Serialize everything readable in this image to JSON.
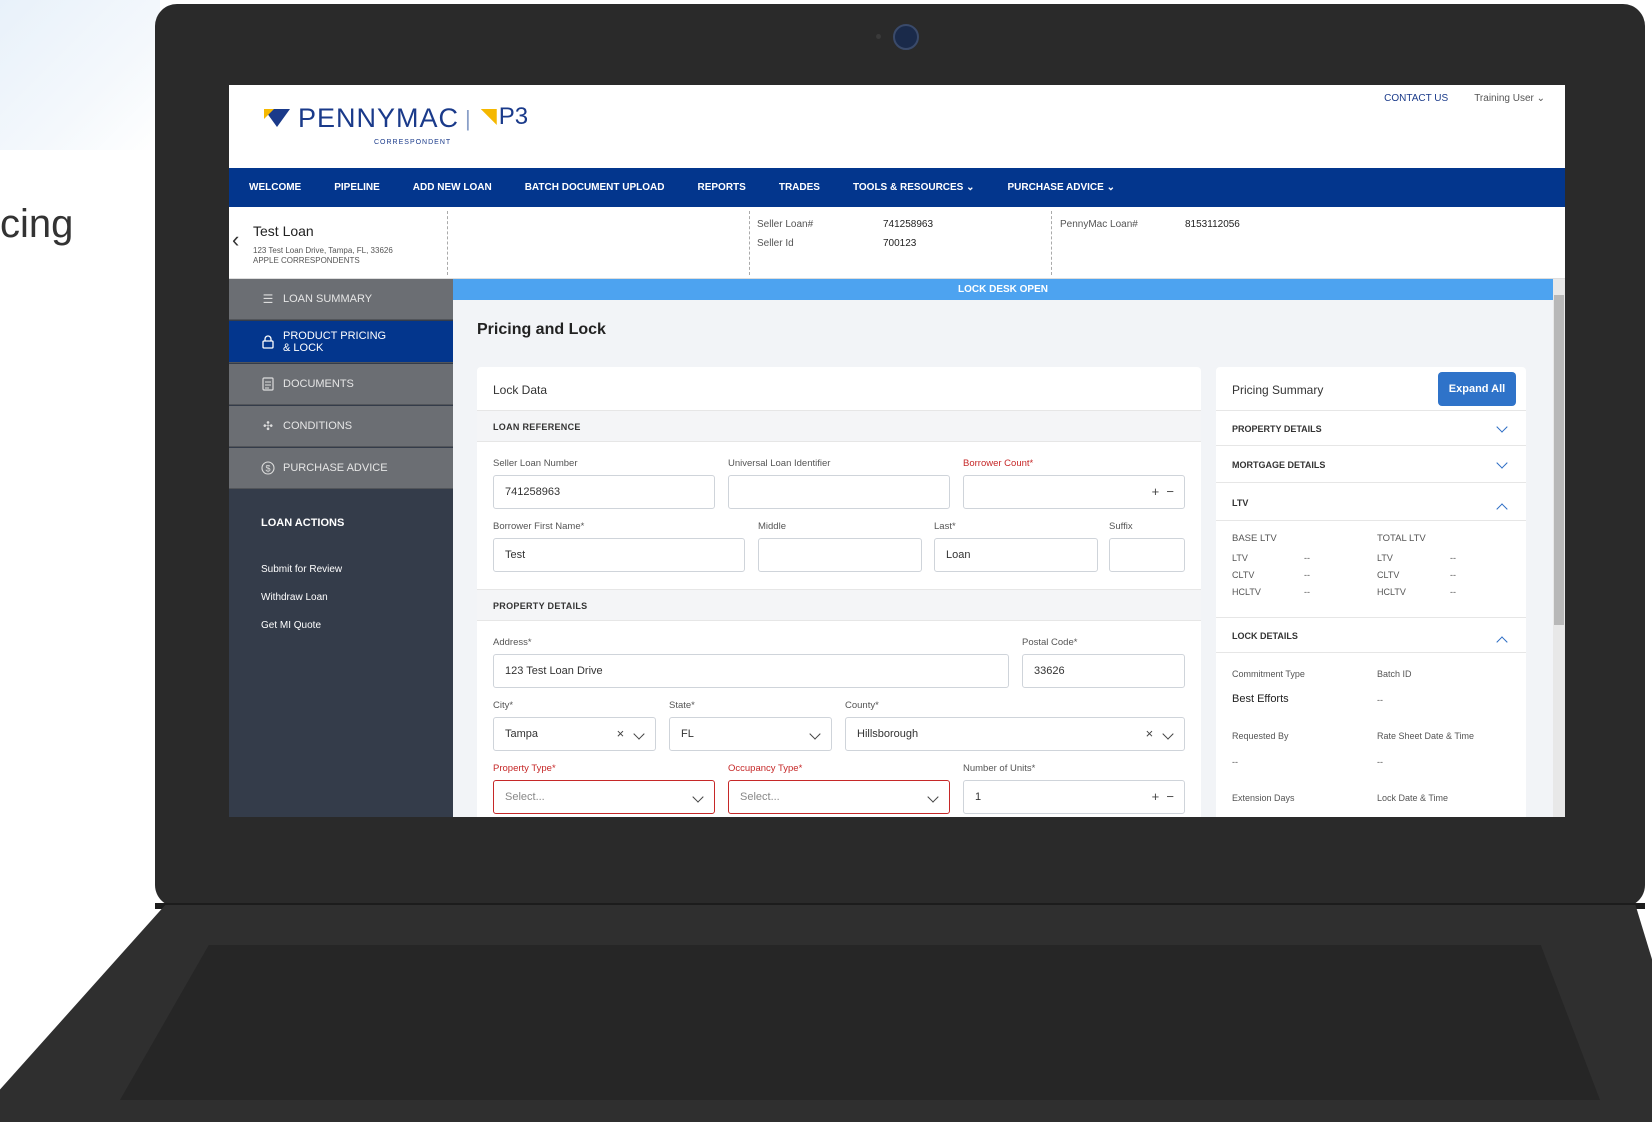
{
  "side_caption": "cing",
  "header": {
    "logo_word": "PENNYMAC",
    "logo_sub": "CORRESPONDENT",
    "logo_sep": "|",
    "logo_p3": "P3",
    "contact": "CONTACT US",
    "user": "Training User ⌄"
  },
  "nav": [
    "WELCOME",
    "PIPELINE",
    "ADD NEW LOAN",
    "BATCH DOCUMENT UPLOAD",
    "REPORTS",
    "TRADES",
    "TOOLS & RESOURCES ⌄",
    "PURCHASE ADVICE ⌄"
  ],
  "loan_bar": {
    "back": "‹",
    "title": "Test Loan",
    "address": "123 Test Loan Drive, Tampa, FL, 33626",
    "correspondent": "APPLE CORRESPONDENTS",
    "seller_loan_label": "Seller Loan#",
    "seller_loan_value": "741258963",
    "seller_id_label": "Seller Id",
    "seller_id_value": "700123",
    "pennymac_loan_label": "PennyMac Loan#",
    "pennymac_loan_value": "8153112056"
  },
  "sidebar": {
    "items": [
      {
        "label": "LOAN SUMMARY",
        "icon": "list-icon"
      },
      {
        "label": "PRODUCT PRICING & LOCK",
        "icon": "lock-icon"
      },
      {
        "label": "DOCUMENTS",
        "icon": "document-icon"
      },
      {
        "label": "CONDITIONS",
        "icon": "conditions-icon"
      },
      {
        "label": "PURCHASE ADVICE",
        "icon": "dollar-icon"
      }
    ],
    "actions_title": "LOAN ACTIONS",
    "actions": [
      "Submit for Review",
      "Withdraw Loan",
      "Get MI Quote"
    ]
  },
  "main": {
    "lock_status": "LOCK DESK OPEN",
    "page_title": "Pricing and Lock",
    "lock_data": {
      "title": "Lock Data",
      "loan_reference": "LOAN REFERENCE",
      "seller_loan_number_label": "Seller Loan Number",
      "seller_loan_number_value": "741258963",
      "uli_label": "Universal Loan Identifier",
      "uli_value": "",
      "borrower_count_label": "Borrower Count*",
      "borrower_count_value": "",
      "first_name_label": "Borrower First Name*",
      "first_name_value": "Test",
      "middle_label": "Middle",
      "middle_value": "",
      "last_label": "Last*",
      "last_value": "Loan",
      "suffix_label": "Suffix",
      "suffix_value": "",
      "property_details": "PROPERTY DETAILS",
      "address_label": "Address*",
      "address_value": "123 Test Loan Drive",
      "postal_label": "Postal Code*",
      "postal_value": "33626",
      "city_label": "City*",
      "city_value": "Tampa",
      "state_label": "State*",
      "state_value": "FL",
      "county_label": "County*",
      "county_value": "Hillsborough",
      "property_type_label": "Property Type*",
      "property_type_placeholder": "Select...",
      "occupancy_type_label": "Occupancy Type*",
      "occupancy_type_placeholder": "Select...",
      "units_label": "Number of Units*",
      "units_value": "1",
      "plus": "+",
      "minus": "−",
      "clear": "×"
    },
    "pricing_summary": {
      "title": "Pricing Summary",
      "expand": "Expand All",
      "property_details": "PROPERTY DETAILS",
      "mortgage_details": "MORTGAGE DETAILS",
      "ltv": "LTV",
      "base_ltv": "BASE LTV",
      "total_ltv": "TOTAL LTV",
      "ltv_rows": [
        "LTV",
        "CLTV",
        "HCLTV"
      ],
      "dash": "--",
      "lock_details": "LOCK DETAILS",
      "commitment_type_label": "Commitment Type",
      "commitment_type_value": "Best Efforts",
      "batch_id_label": "Batch ID",
      "batch_id_value": "--",
      "requested_by_label": "Requested By",
      "requested_by_value": "--",
      "rate_sheet_label": "Rate Sheet Date & Time",
      "rate_sheet_value": "--",
      "extension_days_label": "Extension Days",
      "lock_date_label": "Lock Date & Time"
    }
  },
  "colors": {
    "nav_bg": "#03368d",
    "lock_bar": "#4da3f0",
    "sidebar_bg": "#343c4a",
    "required": "#c62828",
    "expand_btn": "#2f73c9"
  }
}
